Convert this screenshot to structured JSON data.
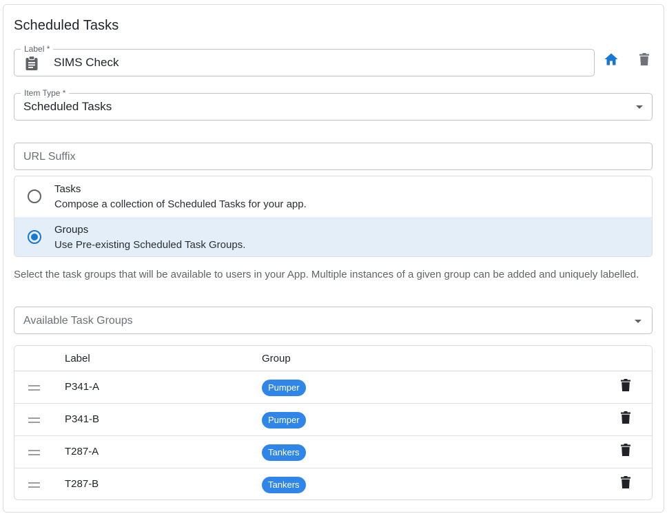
{
  "page": {
    "title": "Scheduled Tasks"
  },
  "label_field": {
    "label": "Label *",
    "value": "SIMS Check",
    "icon": "clipboard-icon"
  },
  "header_actions": {
    "home_icon": "home-icon",
    "delete_icon": "trash-icon",
    "accent": "#1976d2"
  },
  "item_type": {
    "label": "Item Type *",
    "value": "Scheduled Tasks"
  },
  "url_suffix": {
    "placeholder": "URL Suffix"
  },
  "options": [
    {
      "title": "Tasks",
      "description": "Compose a collection of Scheduled Tasks for your app.",
      "selected": false
    },
    {
      "title": "Groups",
      "description": "Use Pre-existing Scheduled Task Groups.",
      "selected": true
    }
  ],
  "help_text": "Select the task groups that will be available to users in your App. Multiple instances of a given group can be added and uniquely labelled.",
  "available_groups": {
    "placeholder": "Available Task Groups"
  },
  "table": {
    "columns": [
      "Label",
      "Group"
    ],
    "rows": [
      {
        "label": "P341-A",
        "group": "Pumper"
      },
      {
        "label": "P341-B",
        "group": "Pumper"
      },
      {
        "label": "T287-A",
        "group": "Tankers"
      },
      {
        "label": "T287-B",
        "group": "Tankers"
      }
    ],
    "chip_color": "#2f86e8"
  }
}
